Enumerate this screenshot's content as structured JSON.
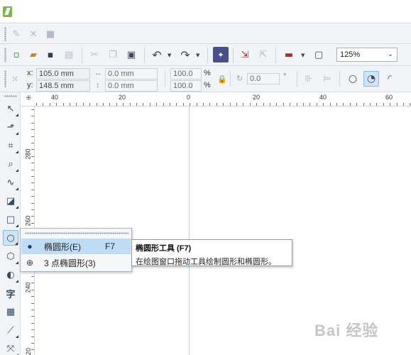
{
  "toolbar": {
    "zoom": "125%"
  },
  "property_bar": {
    "x_label": "x:",
    "x_value": "105.0 mm",
    "y_label": "y:",
    "y_value": "148.5 mm",
    "w_value": "0.0 mm",
    "h_value": "0.0 mm",
    "scale_x": "100.0",
    "scale_y": "100.0",
    "percent": "%",
    "rotation": "0.0",
    "degree": "°"
  },
  "ruler": {
    "h_labels": [
      "40",
      "20",
      "0",
      "20",
      "40",
      "60"
    ],
    "v_labels": [
      "280",
      "260",
      "240",
      "20"
    ]
  },
  "flyout": {
    "items": [
      {
        "label": "椭圆形(E)",
        "shortcut": "F7"
      },
      {
        "label": "3 点椭圆形(3)",
        "shortcut": ""
      }
    ]
  },
  "tooltip": {
    "title": "椭圆形工具 (F7)",
    "description": "在绘图窗口拖动工具绘制圆形和椭圆形。"
  },
  "watermark": {
    "text": "Bai 经验"
  }
}
